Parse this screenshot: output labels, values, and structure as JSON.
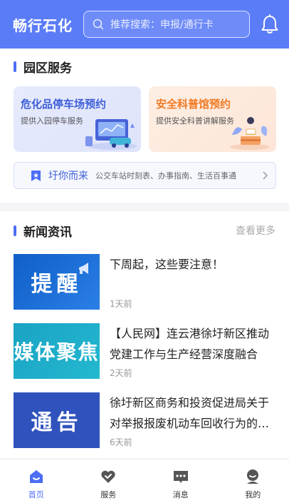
{
  "header": {
    "app_title": "畅行石化",
    "search_placeholder": "推荐搜索：申报/通行卡"
  },
  "park_services": {
    "title": "园区服务",
    "cards": [
      {
        "title": "危化品停车场预约",
        "subtitle": "提供入园停车服务"
      },
      {
        "title": "安全科普馆预约",
        "subtitle": "提供安全科普讲解服务"
      }
    ],
    "notice": {
      "label": "圩你而来",
      "text": "公交车站时刻表、办事指南、生活百事通"
    }
  },
  "news": {
    "title": "新闻资讯",
    "more_label": "查看更多",
    "items": [
      {
        "thumb_text": "提醒",
        "title": "下周起，这些要注意！",
        "date": "1天前"
      },
      {
        "thumb_text": "媒体聚焦",
        "title": "【人民网】连云港徐圩新区推动党建工作与生产经营深度融合",
        "date": "2天前"
      },
      {
        "thumb_text": "通告",
        "title": "徐圩新区商务和投资促进局关于对举报报废机动车回收行为的通告",
        "date": "6天前"
      }
    ]
  },
  "tabbar": {
    "tabs": [
      {
        "label": "首页",
        "icon": "home-icon",
        "active": true
      },
      {
        "label": "服务",
        "icon": "service-icon",
        "active": false
      },
      {
        "label": "消息",
        "icon": "message-icon",
        "active": false
      },
      {
        "label": "我的",
        "icon": "profile-icon",
        "active": false
      }
    ]
  },
  "colors": {
    "brand": "#5b7cf7",
    "accent_blue": "#4c6ef5",
    "accent_orange": "#f07a24"
  }
}
